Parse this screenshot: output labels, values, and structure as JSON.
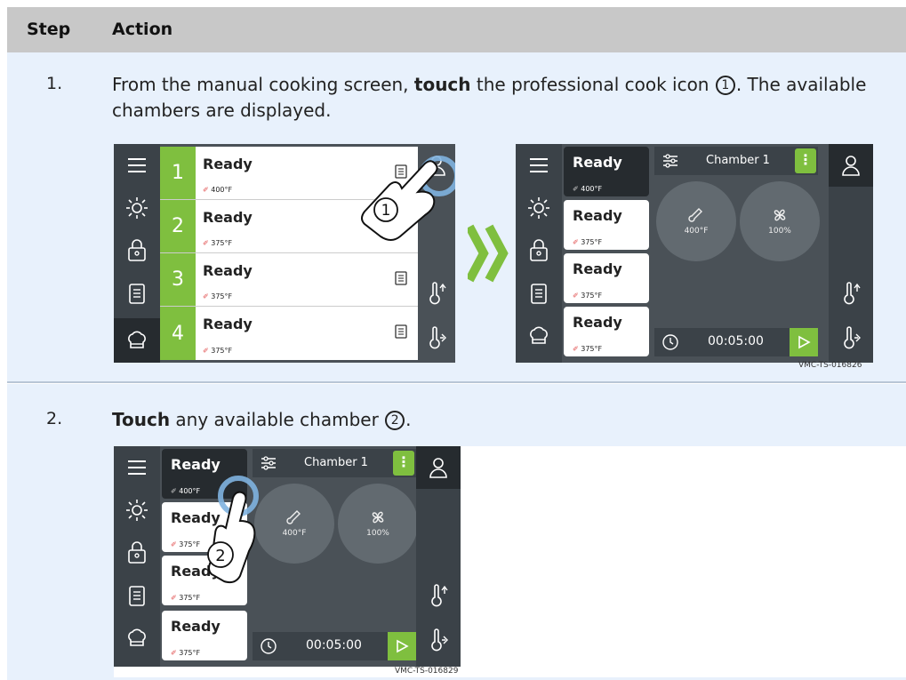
{
  "header": {
    "step": "Step",
    "action": "Action"
  },
  "rows": [
    {
      "step": "1.",
      "text_a": "From the manual cooking screen, ",
      "bold": "touch",
      "text_b": " the professional cook icon ",
      "marker": "1",
      "text_c": ". The available chambers are displayed."
    },
    {
      "step": "2.",
      "bold": "Touch",
      "text_a": " any available chamber ",
      "marker": "2",
      "text_b": "."
    }
  ],
  "screens": {
    "list": {
      "chambers": [
        {
          "num": "1",
          "status": "Ready",
          "temp": "400°F"
        },
        {
          "num": "2",
          "status": "Ready",
          "temp": "375°F"
        },
        {
          "num": "3",
          "status": "Ready",
          "temp": "375°F"
        },
        {
          "num": "4",
          "status": "Ready",
          "temp": "375°F"
        }
      ]
    },
    "detail": {
      "chambers": [
        {
          "status": "Ready",
          "temp": "400°F"
        },
        {
          "status": "Ready",
          "temp": "375°F"
        },
        {
          "status": "Ready",
          "temp": "375°F"
        },
        {
          "status": "Ready",
          "temp": "375°F"
        }
      ],
      "title": "Chamber 1",
      "menu": "⋮",
      "temp_dial": "400°F",
      "fan_dial": "100%",
      "timer": "00:05:00"
    }
  },
  "callouts": {
    "one": "1",
    "two": "2"
  },
  "figure_ids": {
    "fig1": "VMC-TS-016826",
    "fig2": "VMC-TS-016829"
  },
  "colors": {
    "accent": "#7fbf3f",
    "panel": "#4a5157",
    "dark": "#262b2f"
  }
}
